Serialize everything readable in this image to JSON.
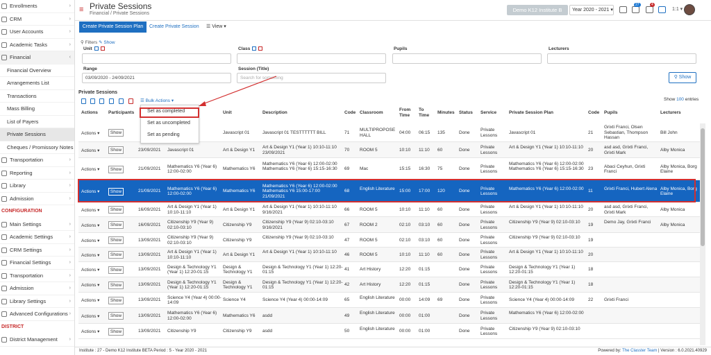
{
  "sidebar": {
    "items": [
      {
        "label": "Enrollments",
        "type": "item"
      },
      {
        "label": "CRM",
        "type": "item"
      },
      {
        "label": "User Accounts",
        "type": "item"
      },
      {
        "label": "Academic Tasks",
        "type": "item"
      },
      {
        "label": "Financial",
        "type": "open"
      },
      {
        "label": "Financial Overview",
        "type": "sub"
      },
      {
        "label": "Arrangements List",
        "type": "sub"
      },
      {
        "label": "Transactions",
        "type": "sub"
      },
      {
        "label": "Mass Billing",
        "type": "sub"
      },
      {
        "label": "List of Payers",
        "type": "sub"
      },
      {
        "label": "Private Sessions",
        "type": "active"
      },
      {
        "label": "Cheques / Promissory Notes",
        "type": "sub"
      },
      {
        "label": "Transportation",
        "type": "item"
      },
      {
        "label": "Reporting",
        "type": "item"
      },
      {
        "label": "Library",
        "type": "item"
      },
      {
        "label": "Admission",
        "type": "item"
      },
      {
        "label": "CONFIGURATION",
        "type": "section"
      },
      {
        "label": "Main Settings",
        "type": "item"
      },
      {
        "label": "Academic Settings",
        "type": "item"
      },
      {
        "label": "CRM Settings",
        "type": "item"
      },
      {
        "label": "Financial Settings",
        "type": "item"
      },
      {
        "label": "Transportation",
        "type": "item"
      },
      {
        "label": "Admission",
        "type": "item"
      },
      {
        "label": "Library Settings",
        "type": "item"
      },
      {
        "label": "Advanced Configurations",
        "type": "item"
      },
      {
        "label": "DISTRICT",
        "type": "section"
      },
      {
        "label": "District Management",
        "type": "item"
      }
    ]
  },
  "header": {
    "title": "Private Sessions",
    "breadcrumb": "Financial  /  Private Sessions",
    "institute": "Demo K12 Institute B",
    "year": "Year 2020 - 2021 ▾",
    "badge1": "27",
    "badge2": "4",
    "zoom": "1:1 ▾"
  },
  "toolbar": {
    "create_plan": "Create Private Session Plan",
    "create_session": "Create Private Session",
    "view": "☰ View ▾"
  },
  "filters": {
    "label": "Filters",
    "show": "Show",
    "unit": "Unit",
    "class": "Class",
    "pupils": "Pupils",
    "lecturers": "Lecturers",
    "range": "Range",
    "range_value": "03/09/2020 - 24/09/2021",
    "session": "Session (Title)",
    "session_placeholder": "Search for something",
    "show_button": "Show"
  },
  "table": {
    "label": "Private Sessions",
    "entries_prefix": "Show",
    "entries_count": "100",
    "entries_suffix": "entries",
    "bulk": "Bulk Actions ▾",
    "bulk_options": [
      "Set as completed",
      "Set as uncompleted",
      "Set as pending"
    ],
    "headers": [
      "Actions",
      "Participants",
      "",
      "Unit",
      "Description",
      "Code",
      "Classroom",
      "From Time",
      "To Time",
      "Minutes",
      "Status",
      "Service",
      "Private Session Plan",
      "Code",
      "Pupils",
      "Lecturers"
    ],
    "action_label": "Actions ▾",
    "show_label": "Show",
    "rows": [
      {
        "date": "",
        "title": "",
        "unit": "Javascript 01",
        "desc": "Javascript 01 TESTTTTTT BILL",
        "code": "71",
        "room": "MULTIPROPOSE HALL",
        "from": "04:00",
        "to": "06:15",
        "min": "135",
        "status": "Done",
        "service": "Private Lessons",
        "plan": "Javascript 01",
        "pcode": "21",
        "pupils": "Grixti Franci, Olsen Sebastian, Thompson Hassan",
        "lect": "Bill John"
      },
      {
        "date": "23/09/2021",
        "title": "Javascript 01",
        "unit": "Art & Design Y1",
        "desc": "Art & Design Y1 (Year 1) 10:10-11:10 23/09/2021",
        "code": "70",
        "room": "ROOM 5",
        "from": "10:10",
        "to": "11:10",
        "min": "60",
        "status": "Done",
        "service": "Private Lessons",
        "plan": "Art & Design Y1 (Year 1) 10:10-11:10",
        "pcode": "20",
        "pupils": "asd asd, Grixti Franci, Grixti Mark",
        "lect": "Alby Monica"
      },
      {
        "date": "21/09/2021",
        "title": "Mathematics Y6 (Year 6) 12:00-02:00",
        "unit": "Mathematics Y6",
        "desc": "Mathematics Y6 (Year 6) 12:00-02:00 Mathematics Y6 (Year 6) 15:15-16:30",
        "code": "69",
        "room": "Mac",
        "from": "15:15",
        "to": "16:30",
        "min": "75",
        "status": "Done",
        "service": "Private Lessons",
        "plan": "Mathematics Y6 (Year 6) 12:00-02:00 Mathematics Y6 (Year 6) 15:15-16:30",
        "pcode": "23",
        "pupils": "Abaci Ceyhun, Grixti Franci",
        "lect": "Alby Monica, Borg Elaine"
      },
      {
        "date": "21/09/2021",
        "title": "Mathematics Y6 (Year 6) 12:00-02:00",
        "unit": "Mathematics Y6",
        "desc": "Mathematics Y6 (Year 6) 12:00-02:00 Mathematics Y6 15:00-17:00 21/09/2021",
        "code": "68",
        "room": "English Literature",
        "from": "15:00",
        "to": "17:00",
        "min": "120",
        "status": "Done",
        "service": "Private Lessons",
        "plan": "Mathematics Y6 (Year 6) 12:00-02:00",
        "pcode": "11",
        "pupils": "Grixti Franci, Hubert Alena",
        "lect": "Alby Monica, Borg Elaine"
      },
      {
        "date": "16/09/2021",
        "title": "Art & Design Y1 (Year 1) 10:10-11:10",
        "unit": "Art & Design Y1",
        "desc": "Art & Design Y1 (Year 1) 10:10-11:10 9/16/2021",
        "code": "66",
        "room": "ROOM 5",
        "from": "10:10",
        "to": "11:10",
        "min": "60",
        "status": "Done",
        "service": "Private Lessons",
        "plan": "Art & Design Y1 (Year 1) 10:10-11:10",
        "pcode": "20",
        "pupils": "asd asd, Grixti Franci, Grixti Mark",
        "lect": "Alby Monica"
      },
      {
        "date": "16/09/2021",
        "title": "Citizenship Y9 (Year 9) 02:10-03:10",
        "unit": "Citizenship Y9",
        "desc": "Citizenship Y9 (Year 9) 02:10-03:10 9/16/2021",
        "code": "67",
        "room": "ROOM 2",
        "from": "02:10",
        "to": "03:10",
        "min": "60",
        "status": "Done",
        "service": "Private Lessons",
        "plan": "Citizenship Y9 (Year 9) 02:10-03:10",
        "pcode": "19",
        "pupils": "Demo Jay, Grixti Franci",
        "lect": "Alby Monica"
      },
      {
        "date": "13/09/2021",
        "title": "Citizenship Y9 (Year 9) 02:10-03:10",
        "unit": "Citizenship Y9",
        "desc": "Citizenship Y9 (Year 9) 02:10-03:10",
        "code": "47",
        "room": "ROOM 5",
        "from": "02:10",
        "to": "03:10",
        "min": "60",
        "status": "Done",
        "service": "Private Lessons",
        "plan": "Citizenship Y9 (Year 9) 02:10-03:10",
        "pcode": "19",
        "pupils": "",
        "lect": ""
      },
      {
        "date": "13/09/2021",
        "title": "Art & Design Y1 (Year 1) 10:10-11:10",
        "unit": "Art & Design Y1",
        "desc": "Art & Design Y1 (Year 1) 10:10-11:10",
        "code": "46",
        "room": "ROOM 5",
        "from": "10:10",
        "to": "11:10",
        "min": "60",
        "status": "Done",
        "service": "Private Lessons",
        "plan": "Art & Design Y1 (Year 1) 10:10-11:10",
        "pcode": "20",
        "pupils": "",
        "lect": ""
      },
      {
        "date": "13/09/2021",
        "title": "Design & Technology Y1 (Year 1) 12:20-01:15",
        "unit": "Design & Technology Y1",
        "desc": "Design & Technology Y1 (Year 1) 12:20-01:15",
        "code": "41",
        "room": "Art History",
        "from": "12:20",
        "to": "01:15",
        "min": "",
        "status": "Done",
        "service": "Private Lessons",
        "plan": "Design & Technology Y1 (Year 1) 12:20-01:15",
        "pcode": "18",
        "pupils": "",
        "lect": ""
      },
      {
        "date": "13/09/2021",
        "title": "Design & Technology Y1 (Year 1) 12:20-01:15",
        "unit": "Design & Technology Y1",
        "desc": "Design & Technology Y1 (Year 1) 12:20-01:15",
        "code": "42",
        "room": "Art History",
        "from": "12:20",
        "to": "01:15",
        "min": "",
        "status": "Done",
        "service": "Private Lessons",
        "plan": "Design & Technology Y1 (Year 1) 12:20-01:15",
        "pcode": "18",
        "pupils": "",
        "lect": ""
      },
      {
        "date": "13/09/2021",
        "title": "Science Y4 (Year 4) 00:00-14:09",
        "unit": "Science Y4",
        "desc": "Science Y4 (Year 4) 00:00-14:09",
        "code": "65",
        "room": "English Literature",
        "from": "00:00",
        "to": "14:09",
        "min": "69",
        "status": "Done",
        "service": "Private Lessons",
        "plan": "Science Y4 (Year 4) 00:00-14:09",
        "pcode": "22",
        "pupils": "Grixti Franci",
        "lect": ""
      },
      {
        "date": "13/09/2021",
        "title": "Mathematics Y6 (Year 6) 12:00-02:00",
        "unit": "Mathematics Y6",
        "desc": "asdd",
        "code": "49",
        "room": "English Literature",
        "from": "00:00",
        "to": "01:00",
        "min": "",
        "status": "Done",
        "service": "Private Lessons",
        "plan": "Mathematics Y6 (Year 6) 12:00-02:00",
        "pcode": "",
        "pupils": "",
        "lect": ""
      },
      {
        "date": "13/09/2021",
        "title": "Citizenship Y9",
        "unit": "Citizenship Y9",
        "desc": "asdd",
        "code": "50",
        "room": "English Literature",
        "from": "00:00",
        "to": "01:00",
        "min": "",
        "status": "Done",
        "service": "Private Lessons",
        "plan": "Citizenship Y9 (Year 9) 02:10-03:10",
        "pcode": "",
        "pupils": "",
        "lect": ""
      }
    ]
  },
  "footer": {
    "left": "Institute : 27 - Demo K12 Institute BETA  Period : 5 - Year 2020 - 2021",
    "powered": "Powered by: ",
    "team": "The Classter Team",
    "version": " | Version : 6.0.2021.40929"
  },
  "colors": {
    "accent": "#1e6fc1",
    "highlight": "#d32f2f",
    "selected_row": "#1565c0"
  }
}
